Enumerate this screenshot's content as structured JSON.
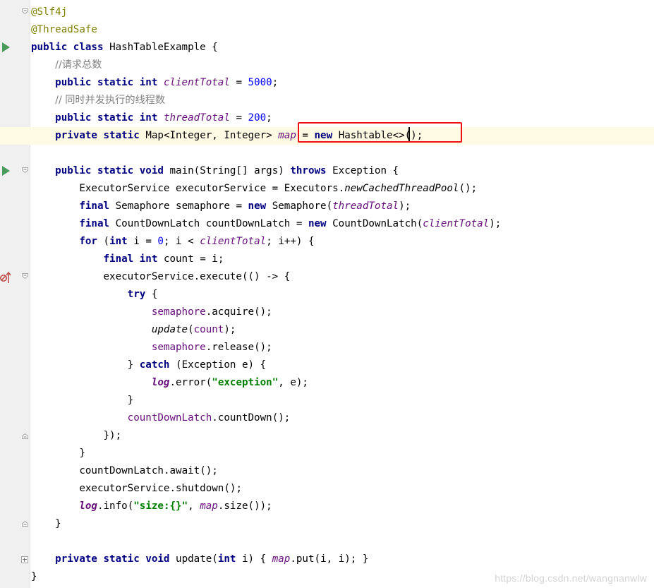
{
  "editor": {
    "language": "java",
    "lines": [
      "@Slf4j",
      "@ThreadSafe",
      "public class HashTableExample {",
      "    //请求总数",
      "    public static int clientTotal = 5000;",
      "    // 同时并发执行的线程数",
      "    public static int threadTotal = 200;",
      "    private static Map<Integer, Integer> map = new Hashtable<>();",
      "",
      "    public static void main(String[] args) throws Exception {",
      "        ExecutorService executorService = Executors.newCachedThreadPool();",
      "        final Semaphore semaphore = new Semaphore(threadTotal);",
      "        final CountDownLatch countDownLatch = new CountDownLatch(clientTotal);",
      "        for (int i = 0; i < clientTotal; i++) {",
      "            final int count = i;",
      "            executorService.execute(() -> {",
      "                try {",
      "                    semaphore.acquire();",
      "                    update(count);",
      "                    semaphore.release();",
      "                } catch (Exception e) {",
      "                    log.error(\"exception\", e);",
      "                }",
      "                countDownLatch.countDown();",
      "            });",
      "        }",
      "        countDownLatch.await();",
      "        executorService.shutdown();",
      "        log.info(\"size:{}\", map.size());",
      "    }",
      "",
      "    private static void update(int i) { map.put(i, i); }",
      "}"
    ],
    "current_line_index": 7
  },
  "gutter_icons": {
    "run_class": "run-icon",
    "run_main": "run-icon",
    "fold": "fold-icon",
    "implements_marker": "override-impl-icon"
  },
  "annotation": {
    "highlight_color": "#ee1111"
  },
  "watermark": "https://blog.csdn.net/wangnanwlw",
  "colors": {
    "keyword": "#000080",
    "annotation": "#808000",
    "comment": "#808080",
    "number": "#0000ff",
    "field": "#660e7a",
    "string": "#008000",
    "current_line": "#fffae3",
    "gutter": "#f0f0f0"
  }
}
